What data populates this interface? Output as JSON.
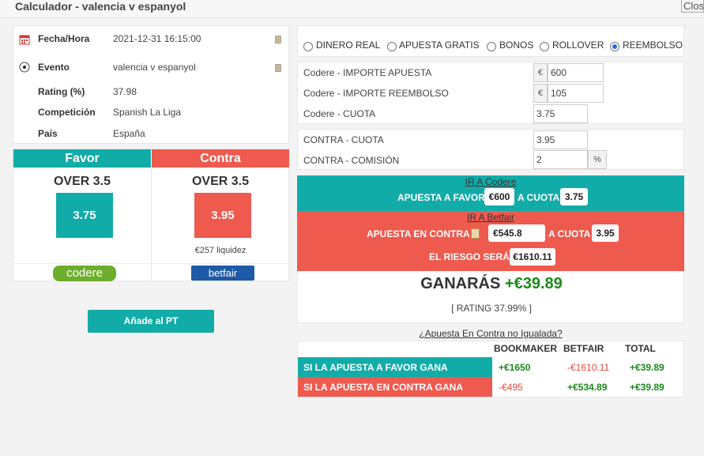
{
  "window": {
    "title": "Calculador - valencia v espanyol",
    "close_label": "Close"
  },
  "event_info": {
    "fecha_label": "Fecha/Hora",
    "fecha_value": "2021-12-31 16:15:00",
    "evento_label": "Evento",
    "evento_value": "valencia v espanyol",
    "rating_label": "Rating (%)",
    "rating_value": "37.98",
    "competicion_label": "Competición",
    "competicion_value": "Spanish La Liga",
    "pais_label": "País",
    "pais_value": "España"
  },
  "favor": {
    "header": "Favor",
    "market": "OVER 3.5",
    "odds": "3.75",
    "bookmaker_logo": "codere",
    "color": "#12aca8"
  },
  "contra": {
    "header": "Contra",
    "market": "OVER 3.5",
    "odds": "3.95",
    "liquidity": "€257 liquidez",
    "exchange_logo": "betfair",
    "color": "#ef5a4f"
  },
  "add_pt_button": "Añade al PT",
  "bet_types": [
    {
      "label": "DINERO REAL",
      "selected": false
    },
    {
      "label": "APUESTA GRATIS",
      "selected": false
    },
    {
      "label": "BONOS",
      "selected": false
    },
    {
      "label": "ROLLOVER",
      "selected": false
    },
    {
      "label": "REEMBOLSO",
      "selected": true
    }
  ],
  "bookmaker_inputs": {
    "importe_label": "Codere - IMPORTE APUESTA",
    "importe_currency": "€",
    "importe_value": "600",
    "reembolso_label": "Codere - IMPORTE REEMBOLSO",
    "reembolso_currency": "€",
    "reembolso_value": "105",
    "cuota_label": "Codere - CUOTA",
    "cuota_value": "3.75"
  },
  "exchange_inputs": {
    "cuota_label": "CONTRA - CUOTA",
    "cuota_value": "3.95",
    "comision_label": "CONTRA - COMISIÓN",
    "comision_value": "2",
    "comision_unit": "%"
  },
  "favor_panel": {
    "link": "IR A Codere",
    "apuesta_label": "APUESTA A FAVOR",
    "apuesta_value": "€600",
    "cuota_label": "A CUOTA",
    "cuota_value": "3.75"
  },
  "contra_panel": {
    "link": "IR A Betfair",
    "apuesta_label": "APUESTA EN CONTRA",
    "apuesta_value": "€545.8",
    "cuota_label": "A CUOTA",
    "cuota_value": "3.95",
    "riesgo_label": "EL RIESGO SERÁ",
    "riesgo_value": "€1610.11"
  },
  "result": {
    "ganaras_label": "GANARÁS",
    "ganaras_value": "+€39.89",
    "rating_text": "[ RATING 37.99% ]"
  },
  "no_igualada_link": "¿Apuesta En Contra no Igualada?",
  "summary": {
    "headers": [
      "BOOKMAKER",
      "BETFAIR",
      "TOTAL"
    ],
    "rows": [
      {
        "label": "SI LA APUESTA A FAVOR GANA",
        "bookmaker": "+€1650",
        "betfair": "-€1610.11",
        "total": "+€39.89"
      },
      {
        "label": "SI LA APUESTA EN CONTRA GANA",
        "bookmaker": "-€495",
        "betfair": "+€534.89",
        "total": "+€39.89"
      }
    ]
  }
}
